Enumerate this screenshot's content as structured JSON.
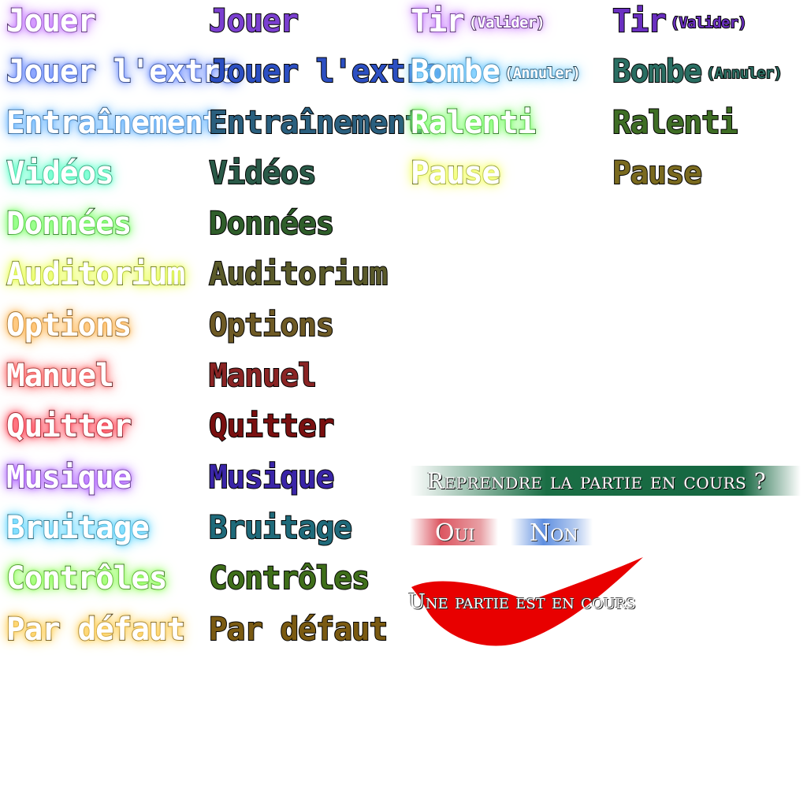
{
  "menu_columns": [
    {
      "variant": "highlighted",
      "items": [
        {
          "label": "Jouer",
          "sub": "",
          "glow": "#c77dff"
        },
        {
          "label": "Jouer l'extra",
          "sub": "",
          "glow": "#6b8cff"
        },
        {
          "label": "Entraînement",
          "sub": "",
          "glow": "#6fb8ff"
        },
        {
          "label": "Vidéos",
          "sub": "",
          "glow": "#5fffc8"
        },
        {
          "label": "Données",
          "sub": "",
          "glow": "#7dff6b"
        },
        {
          "label": "Auditorium",
          "sub": "",
          "glow": "#e8ff5a"
        },
        {
          "label": "Options",
          "sub": "",
          "glow": "#ffb85a"
        },
        {
          "label": "Manuel",
          "sub": "",
          "glow": "#ff6b6b"
        },
        {
          "label": "Quitter",
          "sub": "",
          "glow": "#ff4a5a"
        },
        {
          "label": "Musique",
          "sub": "",
          "glow": "#b36bff"
        },
        {
          "label": "Bruitage",
          "sub": "",
          "glow": "#6bd8ff"
        },
        {
          "label": "Contrôles",
          "sub": "",
          "glow": "#8fff5a"
        },
        {
          "label": "Par défaut",
          "sub": "",
          "glow": "#ffcf5a"
        }
      ]
    },
    {
      "variant": "normal",
      "items": [
        {
          "label": "Jouer",
          "sub": "",
          "color": "#7b3fd0"
        },
        {
          "label": "Jouer l'extra",
          "sub": "",
          "color": "#2c4fc2"
        },
        {
          "label": "Entraînement",
          "sub": "",
          "color": "#2a5f7e"
        },
        {
          "label": "Vidéos",
          "sub": "",
          "color": "#2a5a48"
        },
        {
          "label": "Données",
          "sub": "",
          "color": "#2f5e2a"
        },
        {
          "label": "Auditorium",
          "sub": "",
          "color": "#5a5a2a"
        },
        {
          "label": "Options",
          "sub": "",
          "color": "#6e5a25"
        },
        {
          "label": "Manuel",
          "sub": "",
          "color": "#8a2424"
        },
        {
          "label": "Quitter",
          "sub": "",
          "color": "#7a1010"
        },
        {
          "label": "Musique",
          "sub": "",
          "color": "#3a25a8"
        },
        {
          "label": "Bruitage",
          "sub": "",
          "color": "#1f6a7a"
        },
        {
          "label": "Contrôles",
          "sub": "",
          "color": "#3f6e1a"
        },
        {
          "label": "Par défaut",
          "sub": "",
          "color": "#7a5a12"
        }
      ]
    },
    {
      "variant": "highlighted",
      "items": [
        {
          "label": "Tir",
          "sub": "(Valider)",
          "glow": "#c77dff"
        },
        {
          "label": "Bombe",
          "sub": "(Annuler)",
          "glow": "#6fc8ff"
        },
        {
          "label": "Ralenti",
          "sub": "",
          "glow": "#7dff6b"
        },
        {
          "label": "Pause",
          "sub": "",
          "glow": "#f2ff6b"
        }
      ]
    },
    {
      "variant": "normal",
      "items": [
        {
          "label": "Tir",
          "sub": "(Valider)",
          "color": "#6a2fc0"
        },
        {
          "label": "Bombe",
          "sub": "(Annuler)",
          "color": "#2a6e62"
        },
        {
          "label": "Ralenti",
          "sub": "",
          "color": "#3f6e25"
        },
        {
          "label": "Pause",
          "sub": "",
          "color": "#7a6a1f"
        }
      ]
    }
  ],
  "dialog": {
    "question": "Reprendre la partie en cours ?",
    "yes": "Oui",
    "no": "Non",
    "status": "Une partie est en cours",
    "swoosh_color": "#e80000"
  }
}
